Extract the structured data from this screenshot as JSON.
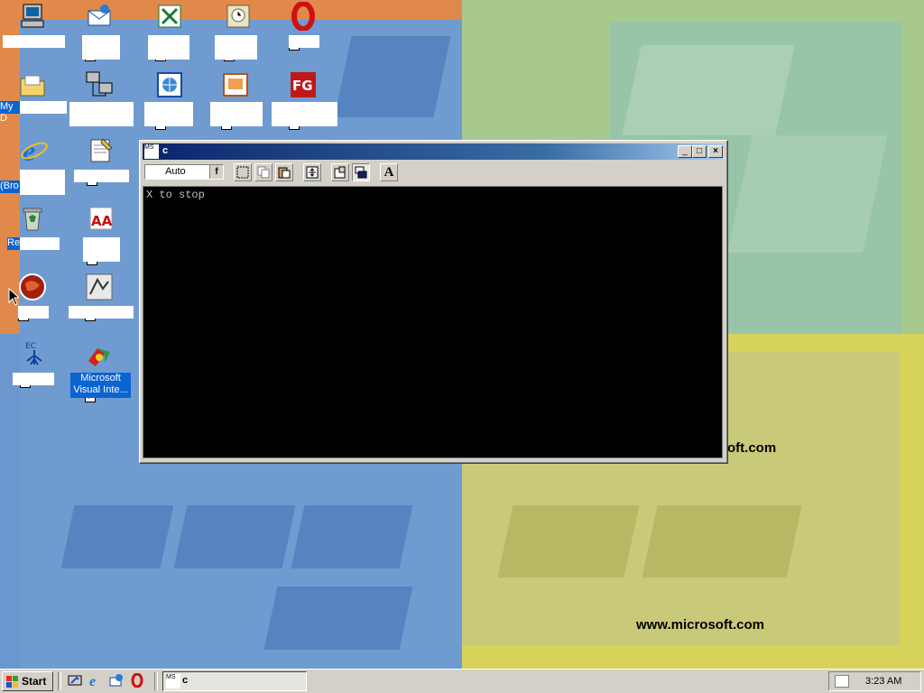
{
  "wallpaper": {
    "url_top": "oft.com",
    "url_bottom": "www.microsoft.com"
  },
  "desktop_icons": [
    {
      "id": "my-computer",
      "label": "",
      "icon": "computer-icon",
      "shortcut": false
    },
    {
      "id": "outlook-express",
      "label": "",
      "icon": "mail-envelope-icon",
      "shortcut": true
    },
    {
      "id": "excel",
      "label": "",
      "icon": "spreadsheet-icon",
      "shortcut": true
    },
    {
      "id": "scheduler",
      "label": "",
      "icon": "presentation-icon",
      "shortcut": true
    },
    {
      "id": "opera",
      "label": "",
      "icon": "opera-icon",
      "shortcut": true
    },
    {
      "id": "my-documents",
      "label": "My D",
      "icon": "folder-icon",
      "shortcut": false
    },
    {
      "id": "network",
      "label": "",
      "icon": "network-computers-icon",
      "shortcut": false
    },
    {
      "id": "web-folder",
      "label": "",
      "icon": "web-folder-icon",
      "shortcut": true
    },
    {
      "id": "powerpoint",
      "label": "",
      "icon": "powerpoint-icon",
      "shortcut": true
    },
    {
      "id": "fg",
      "label": "",
      "icon": "fg-icon",
      "shortcut": true
    },
    {
      "id": "internet-explorer",
      "label": "(Bro",
      "icon": "internet-explorer-icon",
      "shortcut": false
    },
    {
      "id": "notepad",
      "label": "",
      "icon": "notepad-icon",
      "shortcut": true
    },
    {
      "id": "recycle-bin",
      "label": "Re",
      "icon": "recycle-bin-icon",
      "shortcut": false
    },
    {
      "id": "acrobat",
      "label": "",
      "icon": "acrobat-icon",
      "shortcut": true
    },
    {
      "id": "app-red",
      "label": "",
      "icon": "red-globe-icon",
      "shortcut": true
    },
    {
      "id": "app-gray",
      "label": "",
      "icon": "gray-app-icon",
      "shortcut": true
    },
    {
      "id": "app-tree",
      "label": "",
      "icon": "tree-app-icon",
      "shortcut": true
    },
    {
      "id": "visual-interdev",
      "label": "Microsoft Visual Inte...",
      "icon": "visual-interdev-icon",
      "shortcut": true
    }
  ],
  "console_window": {
    "title": "c",
    "icon_text": "MS",
    "font_size": "Auto",
    "font_button": "A",
    "output": "X to stop",
    "buttons": {
      "minimize": "_",
      "maximize": "□",
      "close": "×"
    }
  },
  "taskbar": {
    "start_label": "Start",
    "quick_launch": [
      "desktop-icon",
      "internet-explorer-icon",
      "outlook-icon",
      "opera-icon"
    ],
    "task_label": "c",
    "task_icon_text": "MS",
    "clock": "3:23 AM"
  },
  "colors": {
    "titlebar_start": "#0a246a",
    "titlebar_end": "#a6caf0",
    "selection": "#0a64d2",
    "face": "#d4d0c8"
  }
}
